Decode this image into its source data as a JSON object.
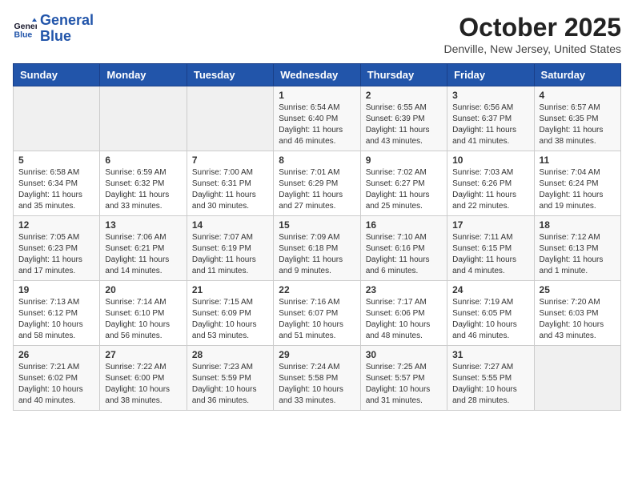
{
  "header": {
    "logo_line1": "General",
    "logo_line2": "Blue",
    "month": "October 2025",
    "location": "Denville, New Jersey, United States"
  },
  "weekdays": [
    "Sunday",
    "Monday",
    "Tuesday",
    "Wednesday",
    "Thursday",
    "Friday",
    "Saturday"
  ],
  "weeks": [
    [
      {
        "day": "",
        "info": ""
      },
      {
        "day": "",
        "info": ""
      },
      {
        "day": "",
        "info": ""
      },
      {
        "day": "1",
        "info": "Sunrise: 6:54 AM\nSunset: 6:40 PM\nDaylight: 11 hours\nand 46 minutes."
      },
      {
        "day": "2",
        "info": "Sunrise: 6:55 AM\nSunset: 6:39 PM\nDaylight: 11 hours\nand 43 minutes."
      },
      {
        "day": "3",
        "info": "Sunrise: 6:56 AM\nSunset: 6:37 PM\nDaylight: 11 hours\nand 41 minutes."
      },
      {
        "day": "4",
        "info": "Sunrise: 6:57 AM\nSunset: 6:35 PM\nDaylight: 11 hours\nand 38 minutes."
      }
    ],
    [
      {
        "day": "5",
        "info": "Sunrise: 6:58 AM\nSunset: 6:34 PM\nDaylight: 11 hours\nand 35 minutes."
      },
      {
        "day": "6",
        "info": "Sunrise: 6:59 AM\nSunset: 6:32 PM\nDaylight: 11 hours\nand 33 minutes."
      },
      {
        "day": "7",
        "info": "Sunrise: 7:00 AM\nSunset: 6:31 PM\nDaylight: 11 hours\nand 30 minutes."
      },
      {
        "day": "8",
        "info": "Sunrise: 7:01 AM\nSunset: 6:29 PM\nDaylight: 11 hours\nand 27 minutes."
      },
      {
        "day": "9",
        "info": "Sunrise: 7:02 AM\nSunset: 6:27 PM\nDaylight: 11 hours\nand 25 minutes."
      },
      {
        "day": "10",
        "info": "Sunrise: 7:03 AM\nSunset: 6:26 PM\nDaylight: 11 hours\nand 22 minutes."
      },
      {
        "day": "11",
        "info": "Sunrise: 7:04 AM\nSunset: 6:24 PM\nDaylight: 11 hours\nand 19 minutes."
      }
    ],
    [
      {
        "day": "12",
        "info": "Sunrise: 7:05 AM\nSunset: 6:23 PM\nDaylight: 11 hours\nand 17 minutes."
      },
      {
        "day": "13",
        "info": "Sunrise: 7:06 AM\nSunset: 6:21 PM\nDaylight: 11 hours\nand 14 minutes."
      },
      {
        "day": "14",
        "info": "Sunrise: 7:07 AM\nSunset: 6:19 PM\nDaylight: 11 hours\nand 11 minutes."
      },
      {
        "day": "15",
        "info": "Sunrise: 7:09 AM\nSunset: 6:18 PM\nDaylight: 11 hours\nand 9 minutes."
      },
      {
        "day": "16",
        "info": "Sunrise: 7:10 AM\nSunset: 6:16 PM\nDaylight: 11 hours\nand 6 minutes."
      },
      {
        "day": "17",
        "info": "Sunrise: 7:11 AM\nSunset: 6:15 PM\nDaylight: 11 hours\nand 4 minutes."
      },
      {
        "day": "18",
        "info": "Sunrise: 7:12 AM\nSunset: 6:13 PM\nDaylight: 11 hours\nand 1 minute."
      }
    ],
    [
      {
        "day": "19",
        "info": "Sunrise: 7:13 AM\nSunset: 6:12 PM\nDaylight: 10 hours\nand 58 minutes."
      },
      {
        "day": "20",
        "info": "Sunrise: 7:14 AM\nSunset: 6:10 PM\nDaylight: 10 hours\nand 56 minutes."
      },
      {
        "day": "21",
        "info": "Sunrise: 7:15 AM\nSunset: 6:09 PM\nDaylight: 10 hours\nand 53 minutes."
      },
      {
        "day": "22",
        "info": "Sunrise: 7:16 AM\nSunset: 6:07 PM\nDaylight: 10 hours\nand 51 minutes."
      },
      {
        "day": "23",
        "info": "Sunrise: 7:17 AM\nSunset: 6:06 PM\nDaylight: 10 hours\nand 48 minutes."
      },
      {
        "day": "24",
        "info": "Sunrise: 7:19 AM\nSunset: 6:05 PM\nDaylight: 10 hours\nand 46 minutes."
      },
      {
        "day": "25",
        "info": "Sunrise: 7:20 AM\nSunset: 6:03 PM\nDaylight: 10 hours\nand 43 minutes."
      }
    ],
    [
      {
        "day": "26",
        "info": "Sunrise: 7:21 AM\nSunset: 6:02 PM\nDaylight: 10 hours\nand 40 minutes."
      },
      {
        "day": "27",
        "info": "Sunrise: 7:22 AM\nSunset: 6:00 PM\nDaylight: 10 hours\nand 38 minutes."
      },
      {
        "day": "28",
        "info": "Sunrise: 7:23 AM\nSunset: 5:59 PM\nDaylight: 10 hours\nand 36 minutes."
      },
      {
        "day": "29",
        "info": "Sunrise: 7:24 AM\nSunset: 5:58 PM\nDaylight: 10 hours\nand 33 minutes."
      },
      {
        "day": "30",
        "info": "Sunrise: 7:25 AM\nSunset: 5:57 PM\nDaylight: 10 hours\nand 31 minutes."
      },
      {
        "day": "31",
        "info": "Sunrise: 7:27 AM\nSunset: 5:55 PM\nDaylight: 10 hours\nand 28 minutes."
      },
      {
        "day": "",
        "info": ""
      }
    ]
  ]
}
